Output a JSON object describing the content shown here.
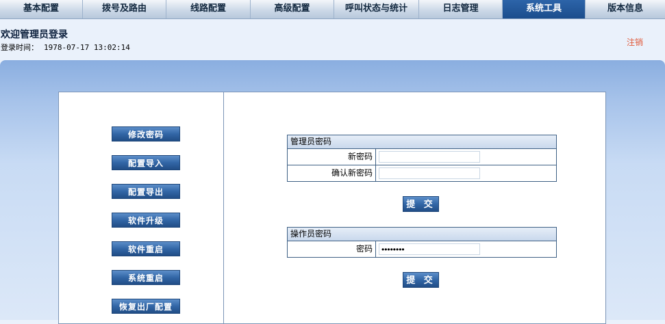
{
  "nav": {
    "items": [
      "基本配置",
      "拨号及路由",
      "线路配置",
      "高级配置",
      "呼叫状态与统计",
      "日志管理",
      "系统工具",
      "版本信息"
    ],
    "active": "系统工具"
  },
  "header": {
    "welcome": "欢迎管理员登录",
    "login_label": "登录时间：",
    "login_time": "1978-07-17 13:02:14",
    "logout": "注销"
  },
  "sidebar": {
    "items": [
      "修改密码",
      "配置导入",
      "配置导出",
      "软件升级",
      "软件重启",
      "系统重启",
      "恢复出厂配置"
    ]
  },
  "admin_form": {
    "title": "管理员密码",
    "new_password_label": "新密码",
    "new_password_value": "",
    "confirm_label": "确认新密码",
    "confirm_value": "",
    "submit": "提 交"
  },
  "operator_form": {
    "title": "操作员密码",
    "password_label": "密码",
    "password_value": "12345678",
    "submit": "提 交"
  },
  "colors": {
    "nav_active": "#1b4d8c",
    "button": "#3266a6",
    "logout": "#e0593a"
  }
}
